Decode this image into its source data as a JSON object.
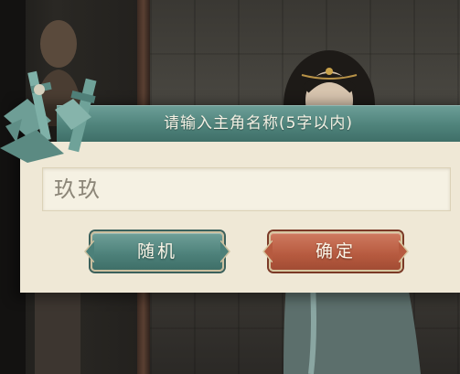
{
  "dialog": {
    "title": "请输入主角名称(5字以内)",
    "name_value": "玖玖",
    "random_label": "随机",
    "confirm_label": "确定"
  },
  "colors": {
    "header_teal": "#4f837b",
    "body_cream": "#efe8d6",
    "random_teal": "#4c8079",
    "confirm_red": "#b65a3f"
  },
  "icons": [
    "sword-crest-decoration",
    "character-silhouette-icon"
  ]
}
